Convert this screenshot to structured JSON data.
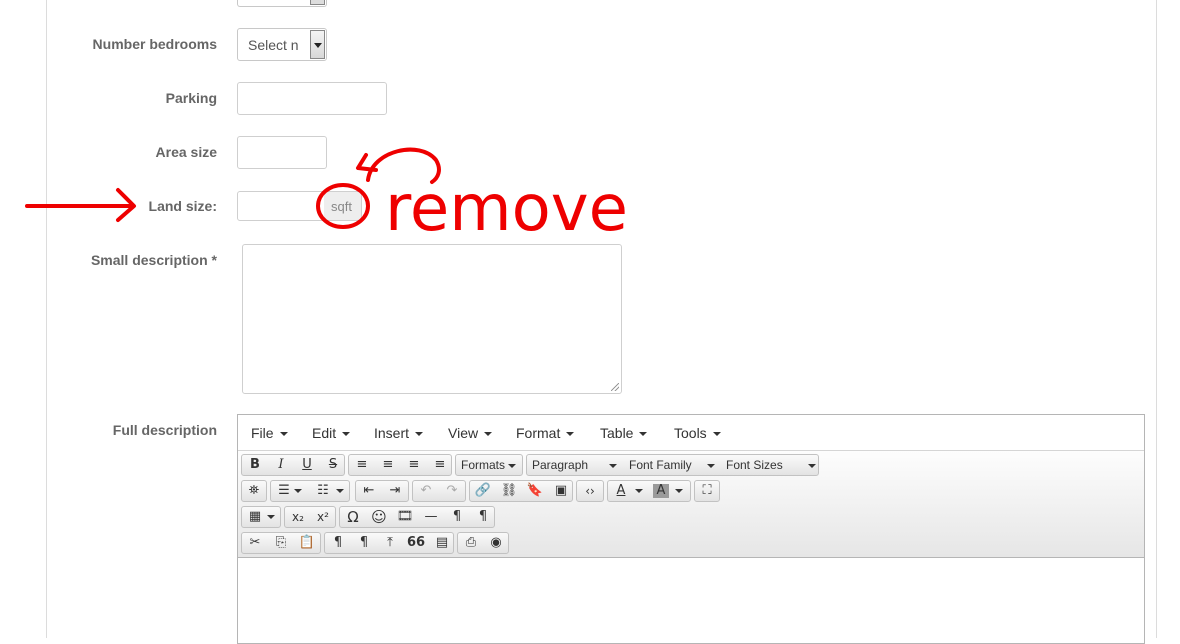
{
  "form": {
    "number_bedrooms": {
      "label": "Number bedrooms",
      "value": "Select n"
    },
    "parking": {
      "label": "Parking",
      "value": ""
    },
    "area_size": {
      "label": "Area size",
      "value": ""
    },
    "land_size": {
      "label": "Land size:",
      "value": "",
      "unit": "sqft"
    },
    "small_description": {
      "label": "Small description *",
      "value": ""
    },
    "full_description": {
      "label": "Full description"
    }
  },
  "editor": {
    "menus": [
      "File",
      "Edit",
      "Insert",
      "View",
      "Format",
      "Table",
      "Tools"
    ],
    "dropdowns": {
      "formats": "Formats",
      "paragraph": "Paragraph",
      "font_family": "Font Family",
      "font_sizes": "Font Sizes"
    },
    "buttons": {
      "bold": "B",
      "italic": "I",
      "underline": "U",
      "strikethrough": "S",
      "subscript": "x₂",
      "superscript": "x²",
      "omega": "Ω",
      "smiley": "☺",
      "quote": "66",
      "text_color": "A",
      "bg_color": "A"
    }
  },
  "annotation": {
    "text": "remove",
    "color": "#ee0000"
  },
  "colors": {
    "label": "#666666",
    "border": "#cfcfcf",
    "addon_bg": "#eeeeee"
  }
}
